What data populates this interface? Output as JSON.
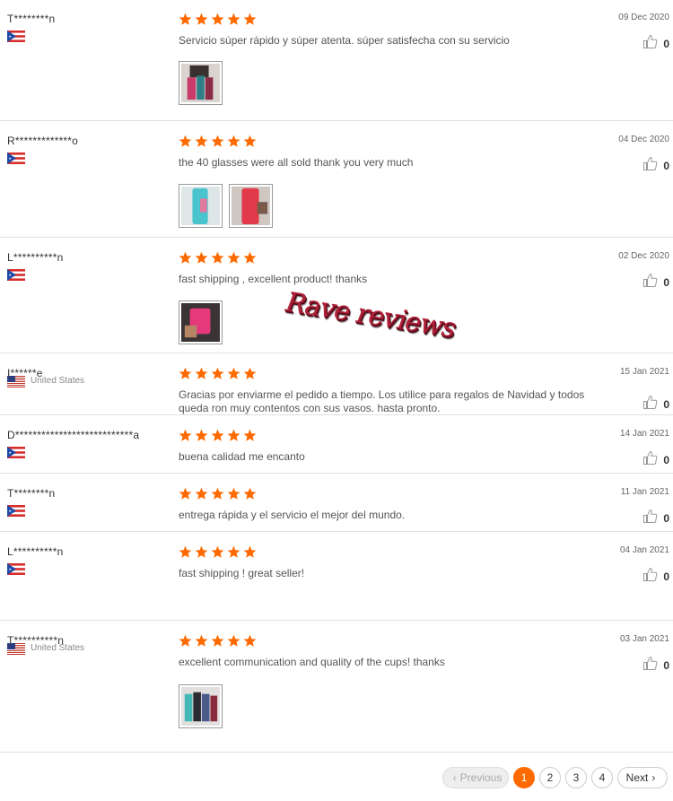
{
  "reviews": [
    {
      "user": "T********n",
      "flag": "pr",
      "country": "",
      "date": "09 Dec 2020",
      "text": "Servicio súper rápido y súper atenta. súper satisfecha con su servicio",
      "likes": "0",
      "photos": [
        "dark-tumblers"
      ]
    },
    {
      "user": "R*************o",
      "flag": "pr",
      "country": "",
      "date": "04 Dec 2020",
      "text": "the 40 glasses were all sold thank you very much",
      "likes": "0",
      "photos": [
        "teal-tumbler",
        "red-tumbler"
      ]
    },
    {
      "user": "L**********n",
      "flag": "pr",
      "country": "",
      "date": "02 Dec 2020",
      "text": "fast shipping , excellent product! thanks",
      "likes": "0",
      "photos": [
        "pink-tumbler"
      ]
    },
    {
      "user": "I******e",
      "flag": "us",
      "country": "United States",
      "date": "15 Jan 2021",
      "text": "Gracias por enviarme el pedido a tiempo. Los utilice para regalos de Navidad y todos queda ron muy contentos con sus vasos. hasta pronto.",
      "likes": "0",
      "photos": []
    },
    {
      "user": "D***************************a",
      "flag": "pr",
      "country": "",
      "date": "14 Jan 2021",
      "text": "buena calidad me encanto",
      "likes": "0",
      "photos": []
    },
    {
      "user": "T********n",
      "flag": "pr",
      "country": "",
      "date": "11 Jan 2021",
      "text": "entrega rápida y el servicio el mejor del mundo.",
      "likes": "0",
      "photos": []
    },
    {
      "user": "L**********n",
      "flag": "pr",
      "country": "",
      "date": "04 Jan 2021",
      "text": "fast shipping ! great seller!",
      "likes": "0",
      "photos": []
    },
    {
      "user": "T**********n",
      "flag": "us",
      "country": "United States",
      "date": "03 Jan 2021",
      "text": "excellent communication and quality of the cups! thanks",
      "likes": "0",
      "photos": [
        "multi-tumblers"
      ]
    }
  ],
  "watermark": "Rave reviews",
  "pagination": {
    "previous": "Previous",
    "pages": [
      "1",
      "2",
      "3",
      "4"
    ],
    "active": "1",
    "next": "Next"
  },
  "colors": {
    "star": "#ff6a00",
    "accent": "#ff6a00"
  }
}
